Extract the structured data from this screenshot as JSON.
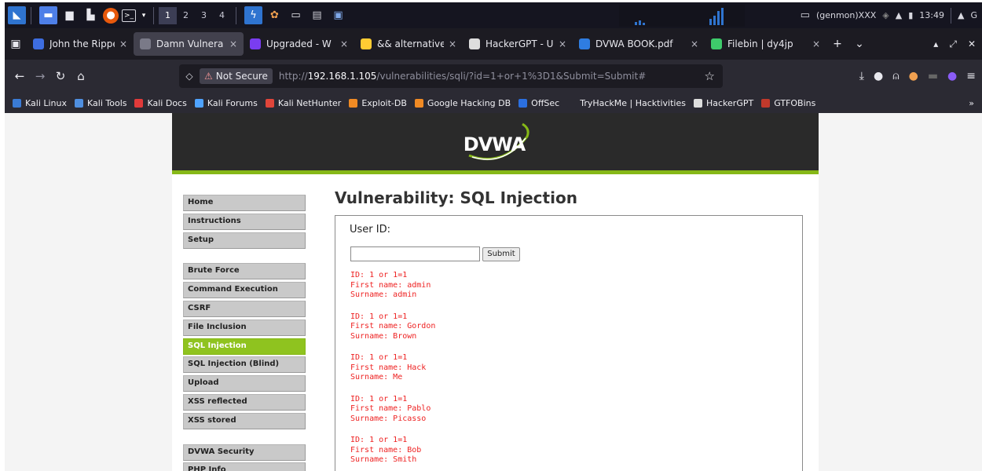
{
  "panel": {
    "workspaces": [
      "1",
      "2",
      "3",
      "4"
    ],
    "user": "(genmon)XXX",
    "clock": "13:49"
  },
  "tabs": [
    {
      "title": "John the Rippe",
      "close": "×",
      "color": "#3d6de0"
    },
    {
      "title": "Damn Vulnera",
      "close": "×",
      "color": "#7a7a88",
      "active": true
    },
    {
      "title": "Upgraded - W",
      "close": "×",
      "color": "#7a3df0"
    },
    {
      "title": "&& alternative",
      "close": "×",
      "color": "#ffcc33"
    },
    {
      "title": "HackerGPT - U",
      "close": "×",
      "color": "#dddddd"
    },
    {
      "title": "DVWA BOOK.pdf",
      "close": "×",
      "color": "#2f7de1"
    },
    {
      "title": "Filebin | dy4jp",
      "close": "×",
      "color": "#3ecb6b"
    }
  ],
  "tabbar": {
    "new_tab": "+",
    "list_all": "⌄"
  },
  "urlbar": {
    "not_secure": "Not Secure",
    "url_prefix": "http://",
    "url_host": "192.168.1.105",
    "url_path": "/vulnerabilities/sqli/?id=1+or+1%3D1&Submit=Submit#"
  },
  "bookmarks": [
    {
      "label": "Kali Linux",
      "color": "#3a7bd5"
    },
    {
      "label": "Kali Tools",
      "color": "#4f8fe0"
    },
    {
      "label": "Kali Docs",
      "color": "#e03a3a"
    },
    {
      "label": "Kali Forums",
      "color": "#4fa3ff"
    },
    {
      "label": "Kali NetHunter",
      "color": "#e0453a"
    },
    {
      "label": "Exploit-DB",
      "color": "#f08a24"
    },
    {
      "label": "Google Hacking DB",
      "color": "#f08a24"
    },
    {
      "label": "OffSec",
      "color": "#2b6fe0"
    },
    {
      "label": "TryHackMe | Hacktivities",
      "color": "#2b2a33"
    },
    {
      "label": "HackerGPT",
      "color": "#dddddd"
    },
    {
      "label": "GTFOBins",
      "color": "#c0392b"
    }
  ],
  "dvwa": {
    "logo": "DVWA",
    "menu_group1": [
      "Home",
      "Instructions",
      "Setup"
    ],
    "menu_group2": [
      "Brute Force",
      "Command Execution",
      "CSRF",
      "File Inclusion",
      "SQL Injection",
      "SQL Injection (Blind)",
      "Upload",
      "XSS reflected",
      "XSS stored"
    ],
    "menu_group3": [
      "DVWA Security",
      "PHP Info"
    ],
    "selected": "SQL Injection",
    "title": "Vulnerability: SQL Injection",
    "user_id_label": "User ID:",
    "input_value": "",
    "submit_label": "Submit",
    "results": [
      {
        "id": "ID: 1 or 1=1",
        "first": "First name: admin",
        "surname": "Surname: admin"
      },
      {
        "id": "ID: 1 or 1=1",
        "first": "First name: Gordon",
        "surname": "Surname: Brown"
      },
      {
        "id": "ID: 1 or 1=1",
        "first": "First name: Hack",
        "surname": "Surname: Me"
      },
      {
        "id": "ID: 1 or 1=1",
        "first": "First name: Pablo",
        "surname": "Surname: Picasso"
      },
      {
        "id": "ID: 1 or 1=1",
        "first": "First name: Bob",
        "surname": "Surname: Smith"
      }
    ]
  }
}
